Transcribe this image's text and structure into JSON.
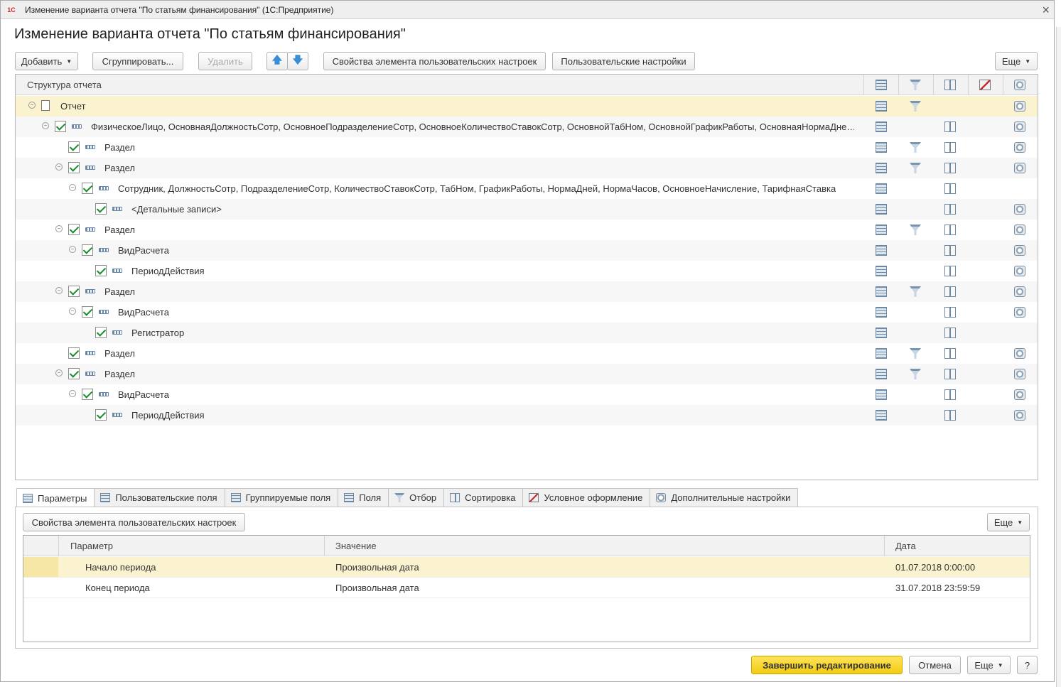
{
  "window": {
    "title": "Изменение варианта отчета \"По статьям финансирования\"  (1С:Предприятие)",
    "logo": "1С",
    "close_icon": "×"
  },
  "form_title": "Изменение варианта отчета \"По статьям финансирования\"",
  "toolbar": {
    "add": "Добавить",
    "group": "Сгруппировать...",
    "delete": "Удалить",
    "up": "🡅",
    "down": "🡇",
    "item_props": "Свойства элемента пользовательских настроек",
    "user_settings": "Пользовательские настройки",
    "more": "Еще"
  },
  "tree": {
    "header": "Структура отчета",
    "rows": [
      {
        "text": "Отчет",
        "cols": [
          1,
          1,
          0,
          0,
          1
        ]
      },
      {
        "text": "ФизическоеЛицо, ОсновнаяДолжностьСотр, ОсновноеПодразделениеСотр, ОсновноеКоличествоСтавокСотр, ОсновнойТабНом, ОсновнойГрафикРаботы, ОсновнаяНормаДне…",
        "cols": [
          1,
          0,
          1,
          0,
          1
        ]
      },
      {
        "text": "Раздел",
        "cols": [
          1,
          1,
          1,
          0,
          1
        ]
      },
      {
        "text": "Раздел",
        "cols": [
          1,
          1,
          1,
          0,
          1
        ]
      },
      {
        "text": "Сотрудник, ДолжностьСотр, ПодразделениеСотр, КоличествоСтавокСотр, ТабНом, ГрафикРаботы, НормаДней, НормаЧасов, ОсновноеНачисление, ТарифнаяСтавка",
        "cols": [
          1,
          0,
          1,
          0,
          0
        ]
      },
      {
        "text": "<Детальные записи>",
        "cols": [
          1,
          0,
          1,
          0,
          1
        ]
      },
      {
        "text": "Раздел",
        "cols": [
          1,
          1,
          1,
          0,
          1
        ]
      },
      {
        "text": "ВидРасчета",
        "cols": [
          1,
          0,
          1,
          0,
          1
        ]
      },
      {
        "text": "ПериодДействия",
        "cols": [
          1,
          0,
          1,
          0,
          1
        ]
      },
      {
        "text": "Раздел",
        "cols": [
          1,
          1,
          1,
          0,
          1
        ]
      },
      {
        "text": "ВидРасчета",
        "cols": [
          1,
          0,
          1,
          0,
          1
        ]
      },
      {
        "text": "Регистратор",
        "cols": [
          1,
          0,
          1,
          0,
          0
        ]
      },
      {
        "text": "Раздел",
        "cols": [
          1,
          1,
          1,
          0,
          1
        ]
      },
      {
        "text": "Раздел",
        "cols": [
          1,
          1,
          1,
          0,
          1
        ]
      },
      {
        "text": "ВидРасчета",
        "cols": [
          1,
          0,
          1,
          0,
          1
        ]
      },
      {
        "text": "ПериодДействия",
        "cols": [
          1,
          0,
          1,
          0,
          1
        ]
      }
    ]
  },
  "tabs": [
    {
      "label": "Параметры",
      "icon": "parameters-icon"
    },
    {
      "label": "Пользовательские поля",
      "icon": "user-fields-icon"
    },
    {
      "label": "Группируемые поля",
      "icon": "grouping-fields-icon"
    },
    {
      "label": "Поля",
      "icon": "fields-icon"
    },
    {
      "label": "Отбор",
      "icon": "filter-icon"
    },
    {
      "label": "Сортировка",
      "icon": "sort-icon"
    },
    {
      "label": "Условное оформление",
      "icon": "conditional-format-icon"
    },
    {
      "label": "Дополнительные настройки",
      "icon": "extra-settings-icon"
    }
  ],
  "params": {
    "item_props": "Свойства элемента пользовательских настроек",
    "more": "Еще",
    "headers": {
      "param": "Параметр",
      "value": "Значение",
      "date": "Дата"
    },
    "rows": [
      {
        "param": "Начало периода",
        "value": "Произвольная дата",
        "date": "01.07.2018 0:00:00"
      },
      {
        "param": "Конец периода",
        "value": "Произвольная дата",
        "date": "31.07.2018 23:59:59"
      }
    ]
  },
  "footer": {
    "finish": "Завершить редактирование",
    "cancel": "Отмена",
    "more": "Еще",
    "help": "?"
  }
}
